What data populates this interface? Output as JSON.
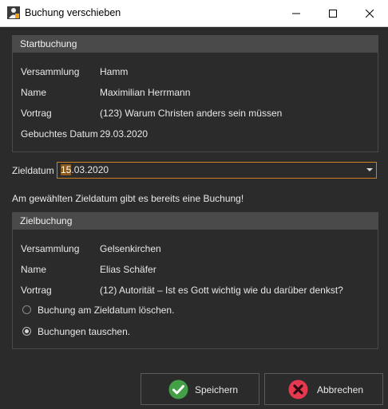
{
  "window": {
    "title": "Buchung verschieben"
  },
  "start": {
    "header": "Startbuchung",
    "rows": [
      {
        "label": "Versammlung",
        "value": "Hamm"
      },
      {
        "label": "Name",
        "value": "Maximilian Herrmann"
      },
      {
        "label": "Vortrag",
        "value": "(123) Warum Christen anders sein müssen"
      },
      {
        "label": "Gebuchtes Datum",
        "value": "29.03.2020"
      }
    ]
  },
  "target_date": {
    "label": "Zieldatum",
    "value_selected": "15",
    "value_rest": ".03.2020"
  },
  "warning": "Am gewählten Zieldatum gibt es bereits eine Buchung!",
  "ziel": {
    "header": "Zielbuchung",
    "rows": [
      {
        "label": "Versammlung",
        "value": "Gelsenkirchen"
      },
      {
        "label": "Name",
        "value": "Elias Schäfer"
      },
      {
        "label": "Vortrag",
        "value": "(12) Autorität – Ist es Gott wichtig wie du darüber denkst?"
      }
    ],
    "options": [
      {
        "label": "Buchung am Zieldatum löschen.",
        "checked": false
      },
      {
        "label": "Buchungen tauschen.",
        "checked": true
      }
    ]
  },
  "buttons": {
    "save": "Speichern",
    "cancel": "Abbrechen"
  },
  "colors": {
    "background": "#2b2b2b",
    "group_header": "#4a4a4a",
    "accent_border": "#d08020",
    "save_icon": "#43a047",
    "cancel_icon": "#e53950"
  }
}
